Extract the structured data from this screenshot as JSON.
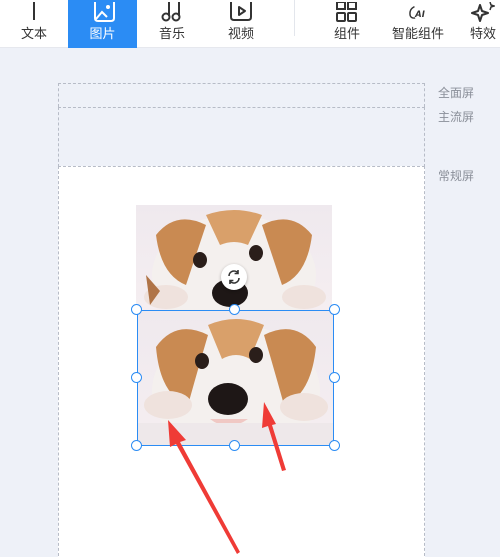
{
  "toolbar": {
    "items": [
      {
        "label": "文本",
        "icon": "text-icon",
        "active": false
      },
      {
        "label": "图片",
        "icon": "image-icon",
        "active": true
      },
      {
        "label": "音乐",
        "icon": "music-icon",
        "active": false
      },
      {
        "label": "视频",
        "icon": "video-icon",
        "active": false
      },
      {
        "label": "组件",
        "icon": "components-icon",
        "active": false
      },
      {
        "label": "智能组件",
        "icon": "ai-components-icon",
        "active": false
      },
      {
        "label": "特效",
        "icon": "effects-icon",
        "active": false
      }
    ],
    "ai_glyph": "AI",
    "active_color": "#2b8cf4"
  },
  "canvas_zones": {
    "full_screen": "全面屏",
    "main_screen": "主流屏",
    "regular_screen": "常规屏"
  },
  "canvas": {
    "images": [
      {
        "subject": "puppy photo",
        "selected": false
      },
      {
        "subject": "puppy photo",
        "selected": true
      }
    ],
    "rotate_icon": "rotate-icon",
    "annotation_color": "#ef3b36"
  }
}
